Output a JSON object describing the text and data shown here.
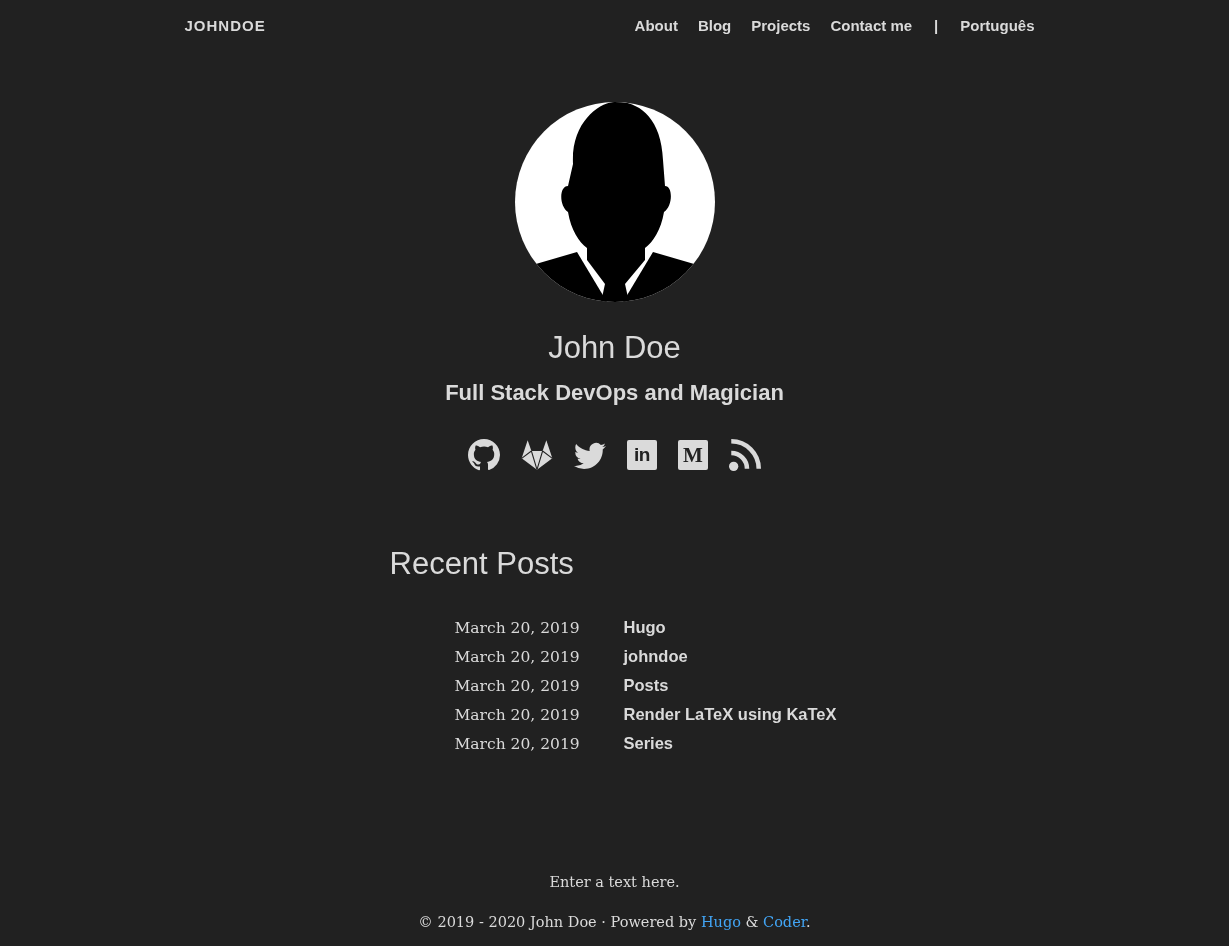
{
  "nav": {
    "brand": "JOHNDOE",
    "items": [
      {
        "kind": "link",
        "label": "About"
      },
      {
        "kind": "link",
        "label": "Blog"
      },
      {
        "kind": "link",
        "label": "Projects"
      },
      {
        "kind": "link",
        "label": "Contact me"
      },
      {
        "kind": "separator",
        "label": "|"
      },
      {
        "kind": "link",
        "label": "Português"
      }
    ]
  },
  "profile": {
    "name": "John Doe",
    "tagline": "Full Stack DevOps and Magician",
    "social": [
      {
        "kind": "github"
      },
      {
        "kind": "gitlab"
      },
      {
        "kind": "twitter"
      },
      {
        "kind": "linkedin",
        "glyph": "in"
      },
      {
        "kind": "medium",
        "glyph": "M"
      },
      {
        "kind": "rss"
      }
    ]
  },
  "recent_posts": {
    "heading": "Recent Posts",
    "posts": [
      {
        "date": "March 20, 2019",
        "title": "Hugo"
      },
      {
        "date": "March 20, 2019",
        "title": "johndoe"
      },
      {
        "date": "March 20, 2019",
        "title": "Posts"
      },
      {
        "date": "March 20, 2019",
        "title": "Render LaTeX using KaTeX"
      },
      {
        "date": "March 20, 2019",
        "title": "Series"
      }
    ]
  },
  "footer": {
    "text": "Enter a text here.",
    "copyright": [
      {
        "kind": "text",
        "text": "© 2019 - 2020 John Doe · Powered by "
      },
      {
        "kind": "link",
        "text": "Hugo"
      },
      {
        "kind": "text",
        "text": " & "
      },
      {
        "kind": "link",
        "text": "Coder"
      },
      {
        "kind": "text",
        "text": "."
      }
    ]
  }
}
